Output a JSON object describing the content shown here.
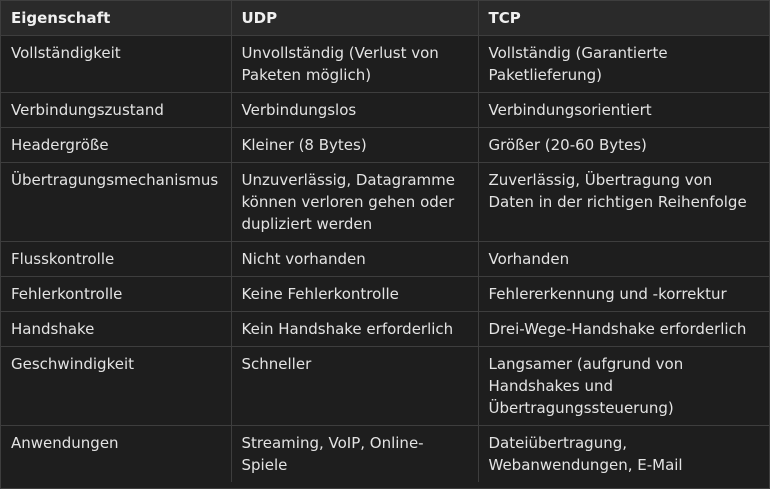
{
  "table": {
    "headers": [
      "Eigenschaft",
      "UDP",
      "TCP"
    ],
    "rows": [
      [
        "Vollständigkeit",
        "Unvollständig (Verlust von Paketen möglich)",
        "Vollständig (Garantierte Paketlieferung)"
      ],
      [
        "Verbindungszustand",
        "Verbindungslos",
        "Verbindungsorientiert"
      ],
      [
        "Headergröße",
        "Kleiner (8 Bytes)",
        "Größer (20-60 Bytes)"
      ],
      [
        "Übertragungsmechanismus",
        "Unzuverlässig, Datagramme können verloren gehen oder dupliziert werden",
        "Zuverlässig, Übertragung von Daten in der richtigen Reihenfolge"
      ],
      [
        "Flusskontrolle",
        "Nicht vorhanden",
        "Vorhanden"
      ],
      [
        "Fehlerkontrolle",
        "Keine Fehlerkontrolle",
        "Fehlererkennung und -korrektur"
      ],
      [
        "Handshake",
        "Kein Handshake erforderlich",
        "Drei-Wege-Handshake erforderlich"
      ],
      [
        "Geschwindigkeit",
        "Schneller",
        "Langsamer (aufgrund von Handshakes und Übertragungssteuerung)"
      ],
      [
        "Anwendungen",
        "Streaming, VoIP, Online-Spiele",
        "Dateiübertragung, Webanwendungen, E-Mail"
      ]
    ]
  },
  "colors": {
    "background": "#1e1e1e",
    "header_background": "#2a2a2a",
    "border": "#3e3e3e",
    "text": "#e3e3e3"
  }
}
